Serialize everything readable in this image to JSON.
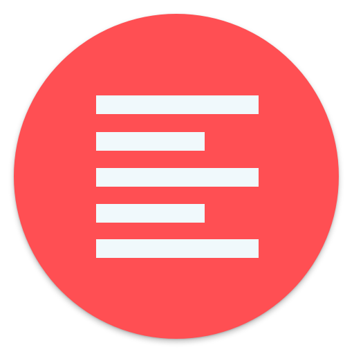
{
  "icon": {
    "name": "lines-app-icon",
    "background_color": "#FF4F53",
    "glyph_color": "#F0F9FC",
    "glyph": "align-left-lines-icon",
    "bars": [
      {
        "length": "long"
      },
      {
        "length": "short"
      },
      {
        "length": "long"
      },
      {
        "length": "short"
      },
      {
        "length": "long"
      }
    ]
  }
}
